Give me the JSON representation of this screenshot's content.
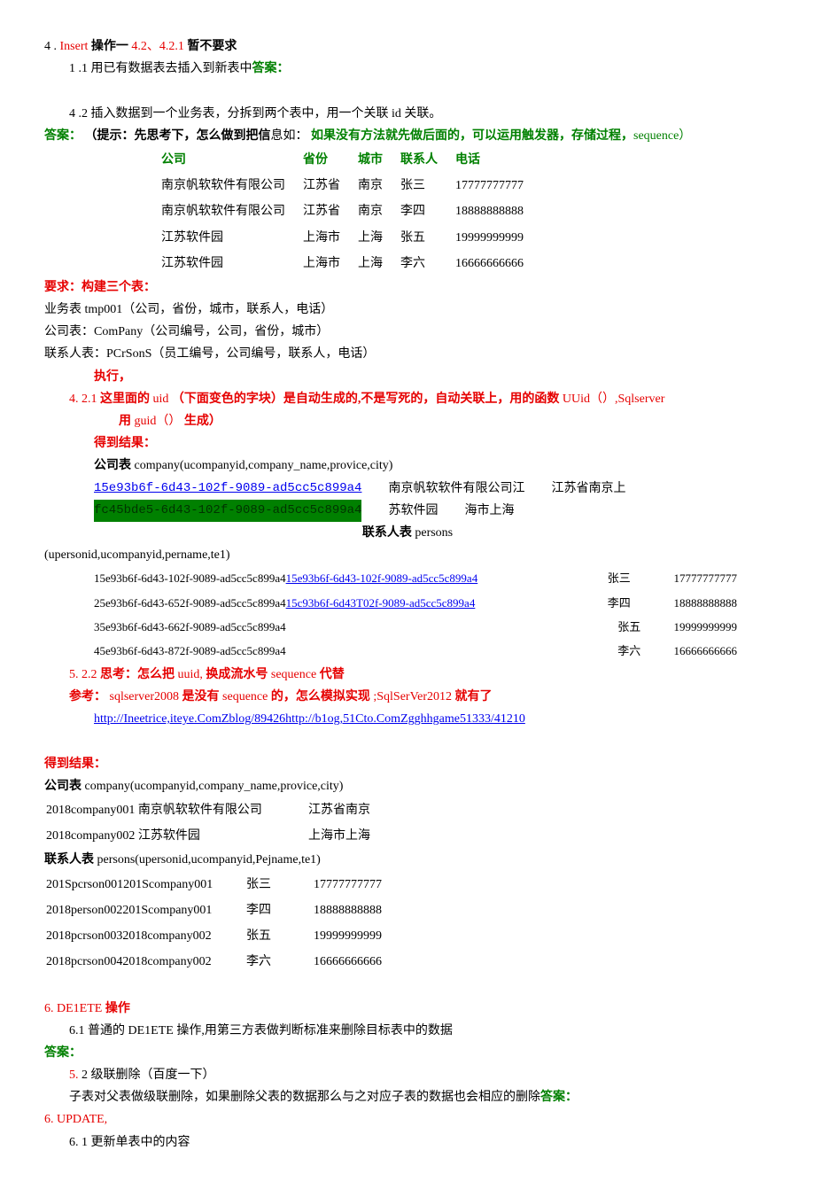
{
  "h4": {
    "num": "4 .",
    "insert": "Insert",
    "op": "操作一",
    "ver": "4.2、4.2.1",
    "tail": "暂不要求"
  },
  "l11": {
    "num": "1 .1",
    "text": "用已有数据表去插入到新表中",
    "ans": "答案："
  },
  "l42": {
    "num": "4    .2",
    "text": "插入数据到一个业务表，分拆到两个表中，用一个关联 id 关联。"
  },
  "ans_line": {
    "ans": "答案：",
    "hint": "（提示：先思考下，怎么做到",
    "baxin": "把信",
    "rest": "息如：",
    "green": "如果没有方法就先做后面的，可以运用触发器，存储过程，",
    "seq": "sequence）"
  },
  "tbl_hdr": {
    "c1": "公司",
    "c2": "省份",
    "c3": "城市",
    "c4": "联系人",
    "c5": "电话"
  },
  "tbl_rows": [
    {
      "c1": "南京帆软软件有限公司",
      "c2": "江苏省",
      "c3": "南京",
      "c4": "张三",
      "c5": "17777777777"
    },
    {
      "c1": "南京帆软软件有限公司",
      "c2": "江苏省",
      "c3": "南京",
      "c4": "李四",
      "c5": "18888888888"
    },
    {
      "c1": "江苏软件园",
      "c2": "上海市",
      "c3": "上海",
      "c4": "张五",
      "c5": "19999999999"
    },
    {
      "c1": "江苏软件园",
      "c2": "上海市",
      "c3": "上海",
      "c4": "李六",
      "c5": "16666666666"
    }
  ],
  "req": "要求：构建三个表：",
  "t1": "业务表 tmp001（公司，省份，城市，联系人，电话）",
  "t2": "公司表：ComPany（公司编号，公司，省份，城市）",
  "t3": "联系人表：PCrSonS（员工编号，公司编号，联系人，电话）",
  "exec": "执行，",
  "s421": {
    "num": "4. 2.1",
    "a": "这里面的",
    "uid": "uid",
    "b": "（下面变色的字块）是自动生成的,不是写死的，自动关联上，用的函数",
    "uuid": "UUid（）,Sqlserver",
    "c": "用",
    "guid": "guid（）",
    "d": "生成）"
  },
  "res1": "得到结果：",
  "comp_h": "公司表",
  "comp_def": " company(ucompanyid,company_name,provice,city)",
  "comp_r1a": "15e93b6f-6d43-102f-9089-ad5cc5c899a4",
  "comp_r1b": "南京帆软软件有限公司江",
  "comp_r1c": "江苏省南京上",
  "comp_r2a": "fc45bde5-6d43-102f-9089-ad5cc5c899a4",
  "comp_r2b": "苏软件园",
  "comp_r2c": "海市上海",
  "pers_h": "联系人表",
  "pers_def": " persons",
  "pers_cols": "(upersonid,ucompanyid,pername,te1)",
  "pers_rows": [
    {
      "a": "15e93b6f-6d43-102f-9089-ad5cc5c899a4",
      "b": "15e93b6f-6d43-102f-9089-ad5cc5c899a4",
      "c": "张三",
      "d": "17777777777"
    },
    {
      "a": "25e93b6f-6d43-652f-9089-ad5cc5c899a4",
      "b": "15c93b6f-6d43T02f-9089-ad5cc5c899a4",
      "c": "李四",
      "d": "18888888888"
    },
    {
      "a": "35e93b6f-6d43-662f-9089-ad5cc5c899a4",
      "b": "",
      "c": "张五",
      "d": "19999999999"
    },
    {
      "a": "45e93b6f-6d43-872f-9089-ad5cc5c899a4",
      "b": "",
      "c": "李六",
      "d": "16666666666"
    }
  ],
  "s522": {
    "num": "5. 2.2",
    "a": "思考：怎么把",
    "uuid": "uuid,",
    "b": "换成流水号",
    "seq": "sequence",
    "c": "代替"
  },
  "ref": {
    "lbl": "参考：",
    "a": "sqlserver2008",
    "b": "是没有",
    "seq": "sequence",
    "c": "的，怎么模拟实现",
    "d": ";SqlSerVer2012",
    "e": "就有了",
    "link": "http://Ineetrice,iteye.ComZblog/89426http://b1og,51Cto.ComZgghhgame51333/41210"
  },
  "res2": "得到结果：",
  "comp2_h": "公司表",
  "comp2_def": " company(ucompanyid,company_name,provice,city)",
  "comp2_rows": [
    {
      "a": "2018company001 南京帆软软件有限公司",
      "b": "江苏省南京"
    },
    {
      "a": "2018company002 江苏软件园",
      "b": "上海市上海"
    }
  ],
  "pers2_h": "联系人表",
  "pers2_def": " persons(upersonid,ucompanyid,Pejname,te1)",
  "pers2_rows": [
    {
      "a": "201Spcrson001201Scompany001",
      "b": "张三",
      "c": "17777777777"
    },
    {
      "a": "2018person002201Scompany001",
      "b": "李四",
      "c": "18888888888"
    },
    {
      "a": "2018pcrson0032018company002",
      "b": "张五",
      "c": "19999999999"
    },
    {
      "a": "2018pcrson0042018company002",
      "b": "李六",
      "c": "16666666666"
    }
  ],
  "s6": {
    "num": "6.",
    "title": "DE1ETE",
    "op": "操作"
  },
  "s61": {
    "num": "6.1",
    "a": "普通的",
    "del": "DE1ETE",
    "b": "操作,用第三方表做判断标准来删除目标表中的数据"
  },
  "ans2": "答案：",
  "s52": {
    "num": "5.",
    "text": "2 级联删除（百度一下）"
  },
  "s52b": {
    "text": "子表对父表做级联删除，如果删除父表的数据那么与之对应子表的数据也会相应的删除",
    "ans": "答案："
  },
  "s6u": {
    "num": "6.",
    "title": "UPDATE,"
  },
  "s61u": {
    "num": "6. 1",
    "text": "更新单表中的内容"
  }
}
